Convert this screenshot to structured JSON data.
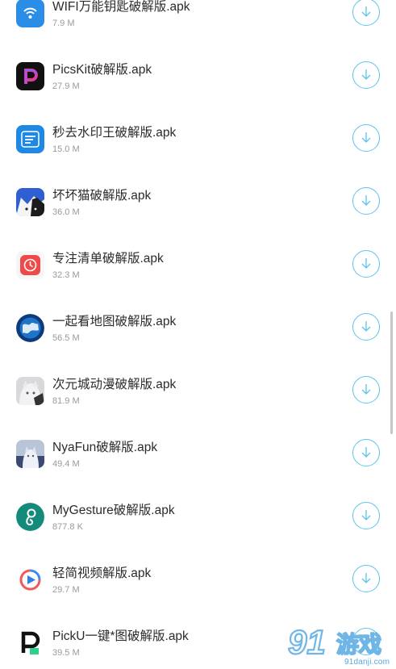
{
  "apps": [
    {
      "name": "WIFI万能钥匙破解版.apk",
      "size": "7.9 M",
      "icon": "wifi-icon"
    },
    {
      "name": "PicsKit破解版.apk",
      "size": "27.9 M",
      "icon": "picskit-icon"
    },
    {
      "name": "秒去水印王破解版.apk",
      "size": "15.0 M",
      "icon": "watermark-remover-icon"
    },
    {
      "name": "坏坏猫破解版.apk",
      "size": "36.0 M",
      "icon": "cat-icon"
    },
    {
      "name": "专注清单破解版.apk",
      "size": "32.3 M",
      "icon": "focus-list-icon"
    },
    {
      "name": "一起看地图破解版.apk",
      "size": "56.5 M",
      "icon": "globe-icon"
    },
    {
      "name": "次元城动漫破解版.apk",
      "size": "81.9 M",
      "icon": "anime-icon"
    },
    {
      "name": "NyaFun破解版.apk",
      "size": "49.4 M",
      "icon": "nyafun-icon"
    },
    {
      "name": "MyGesture破解版.apk",
      "size": "877.8 K",
      "icon": "gesture-icon"
    },
    {
      "name": "轻简视频解版.apk",
      "size": "29.7 M",
      "icon": "video-player-icon"
    },
    {
      "name": "PickU一键*图破解版.apk",
      "size": "39.5 M",
      "icon": "picku-icon"
    }
  ],
  "download_icon": "download-arrow-icon",
  "colors": {
    "accent": "#5cc3ea",
    "title_text": "#2b2b2b",
    "size_text": "#9a9a9a"
  },
  "watermark": {
    "logo_text": "91游戏",
    "domain": "91danji.com"
  }
}
